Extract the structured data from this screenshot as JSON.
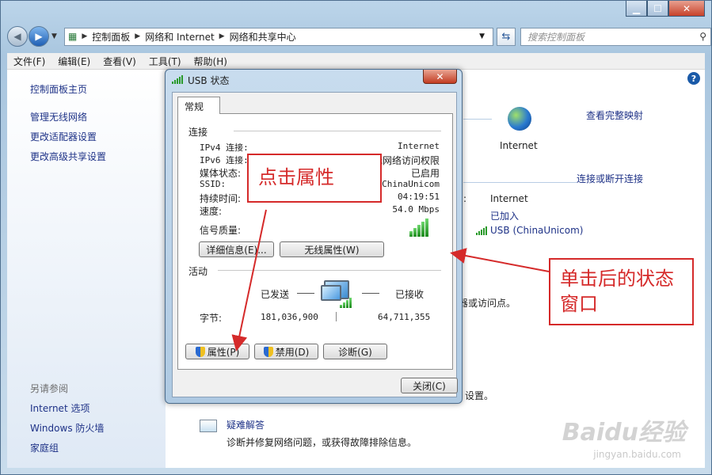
{
  "window": {
    "breadcrumb": [
      "控制面板",
      "网络和 Internet",
      "网络和共享中心"
    ],
    "search_placeholder": "搜索控制面板",
    "menu": [
      "文件(F)",
      "编辑(E)",
      "查看(V)",
      "工具(T)",
      "帮助(H)"
    ]
  },
  "sidebar": {
    "links": [
      "控制面板主页",
      "管理无线网络",
      "更改适配器设置",
      "更改高级共享设置"
    ],
    "see_also_title": "另请参阅",
    "see_also": [
      "Internet 选项",
      "Windows 防火墙",
      "家庭组"
    ]
  },
  "main": {
    "view_full_map": "查看完整映射",
    "internet_label": "Internet",
    "connect_disconnect": "连接或断开连接",
    "access_type_value": "Internet",
    "homegroup_value": "已加入",
    "connection_value": "USB (ChinaUnicom)",
    "access_point_text": "器或访问点。",
    "settings_text": "设置。",
    "troubleshoot_link": "疑难解答",
    "troubleshoot_desc": "诊断并修复网络问题，或获得故障排除信息。"
  },
  "dialog": {
    "title": "USB 状态",
    "tab": "常规",
    "connection_group": "连接",
    "rows": [
      {
        "label": "IPv4 连接:",
        "value": "Internet"
      },
      {
        "label": "IPv6 连接:",
        "value": "无网络访问权限"
      },
      {
        "label": "媒体状态:",
        "value": "已启用"
      },
      {
        "label": "SSID:",
        "value": "ChinaUnicom"
      },
      {
        "label": "持续时间:",
        "value": "04:19:51"
      },
      {
        "label": "速度:",
        "value": "54.0 Mbps"
      }
    ],
    "signal_label": "信号质量:",
    "details_button": "详细信息(E)...",
    "wireless_props_button": "无线属性(W)",
    "activity_group": "活动",
    "sent_label": "已发送",
    "received_label": "已接收",
    "bytes_label": "字节:",
    "bytes_sent": "181,036,900",
    "bytes_received": "64,711,355",
    "properties_button": "属性(P)",
    "disable_button": "禁用(D)",
    "diagnose_button": "诊断(G)",
    "close_button": "关闭(C)"
  },
  "annotations": {
    "click_properties": "点击属性",
    "status_window": "单击后的状态窗口"
  },
  "watermark": {
    "brand": "Baidu经验",
    "url": "jingyan.baidu.com"
  },
  "colors": {
    "annotation_red": "#d52a2a",
    "link_blue": "#1e3287",
    "signal_green": "#2a9a2a"
  }
}
